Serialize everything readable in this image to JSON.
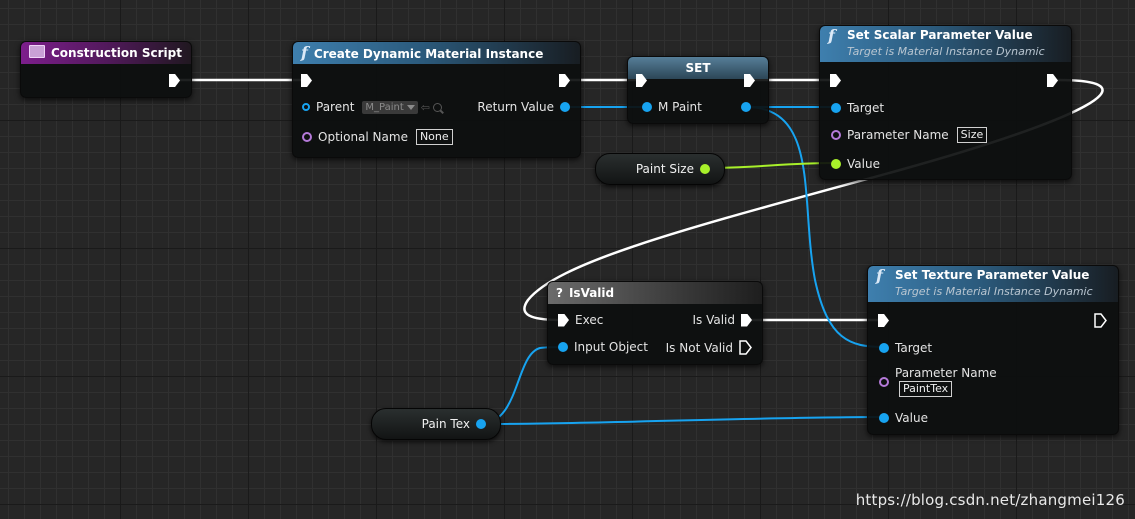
{
  "nodes": {
    "construction_script": {
      "title": "Construction Script"
    },
    "create_dmi": {
      "title": "Create Dynamic Material Instance",
      "parent_label": "Parent",
      "parent_value": "M_Paint",
      "optional_name_label": "Optional Name",
      "optional_name_value": "None",
      "return_label": "Return Value"
    },
    "set_var": {
      "title": "SET",
      "var_label": "M Paint"
    },
    "set_scalar": {
      "title": "Set Scalar Parameter Value",
      "subtitle": "Target is Material Instance Dynamic",
      "target_label": "Target",
      "param_label": "Parameter Name",
      "param_value": "Size",
      "value_label": "Value"
    },
    "paint_size": {
      "label": "Paint Size"
    },
    "is_valid": {
      "title": "IsValid",
      "exec_label": "Exec",
      "input_label": "Input Object",
      "is_valid_label": "Is Valid",
      "is_not_valid_label": "Is Not Valid"
    },
    "set_texture": {
      "title": "Set Texture Parameter Value",
      "subtitle": "Target is Material Instance Dynamic",
      "target_label": "Target",
      "param_label": "Parameter Name",
      "param_value": "PaintTex",
      "value_label": "Value"
    },
    "pain_tex": {
      "label": "Pain Tex"
    }
  },
  "watermark": "https://blog.csdn.net/zhangmei126",
  "colors": {
    "exec_wire": "#ffffff",
    "object_pin": "#17a3f0",
    "name_pin": "#b57ad9",
    "float_pin": "#a8f02a",
    "function_header": "#3e7fae",
    "event_header": "#7d1e8c"
  },
  "icons": [
    "function-icon",
    "event-icon",
    "question-icon",
    "exec-pin-icon",
    "data-pin-icon",
    "dropdown-caret-icon",
    "use-selected-arrow-icon",
    "browse-magnifier-icon"
  ]
}
